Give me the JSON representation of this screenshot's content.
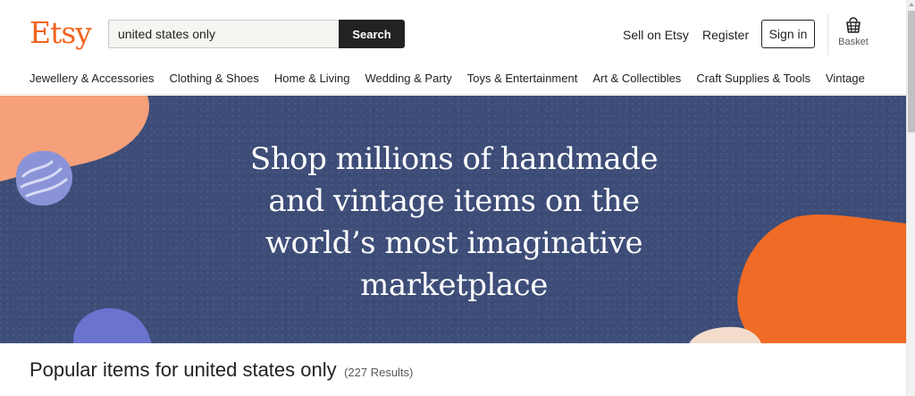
{
  "header": {
    "logo": "Etsy",
    "search": {
      "value": "united states only",
      "button_label": "Search"
    },
    "sell_label": "Sell on Etsy",
    "register_label": "Register",
    "signin_label": "Sign in",
    "basket_label": "Basket",
    "basket_icon": "basket-icon"
  },
  "categories": [
    "Jewellery & Accessories",
    "Clothing & Shoes",
    "Home & Living",
    "Wedding & Party",
    "Toys & Entertainment",
    "Art & Collectibles",
    "Craft Supplies & Tools",
    "Vintage"
  ],
  "hero": {
    "lines": [
      "Shop millions of handmade",
      "and vintage items on the",
      "world’s most imaginative",
      "marketplace"
    ]
  },
  "results": {
    "title": "Popular items for united states only",
    "count": "(227 Results)"
  },
  "colors": {
    "brand": "#f1641e",
    "hero_bg": "#3d4d78",
    "peach": "#f5a07a",
    "orange": "#f06b25",
    "lavender": "#8b93d8",
    "blue_blob": "#6a74d0"
  }
}
